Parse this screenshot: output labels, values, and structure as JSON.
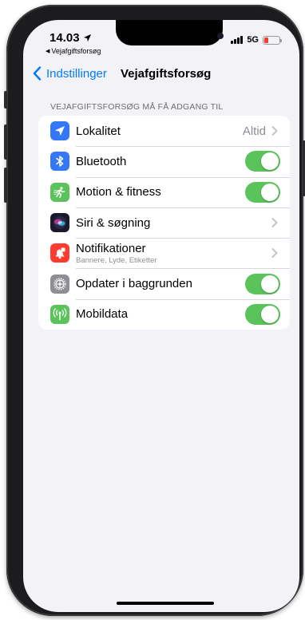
{
  "status_bar": {
    "time": "14.03",
    "back_app_label": "Vejafgiftsforsøg",
    "network": "5G",
    "battery_color": "#ff3b30"
  },
  "nav": {
    "back_label": "Indstillinger",
    "title": "Vejafgiftsforsøg"
  },
  "section": {
    "header": "VEJAFGIFTSFORSØG MÅ FÅ ADGANG TIL",
    "rows": [
      {
        "label": "Lokalitet",
        "value": "Altid",
        "icon": "location-arrow-icon",
        "icon_color": "#3478f6",
        "control": "disclosure"
      },
      {
        "label": "Bluetooth",
        "icon": "bluetooth-icon",
        "icon_color": "#3478f6",
        "control": "toggle",
        "on": true
      },
      {
        "label": "Motion & fitness",
        "icon": "running-figure-icon",
        "icon_color": "#5ac35a",
        "control": "toggle",
        "on": true
      },
      {
        "label": "Siri & søgning",
        "icon": "siri-icon",
        "icon_color": "#1a1a2e",
        "control": "disclosure"
      },
      {
        "label": "Notifikationer",
        "sublabel": "Bannere, Lyde, Etiketter",
        "icon": "bell-icon",
        "icon_color": "#ff3b30",
        "control": "disclosure"
      },
      {
        "label": "Opdater i baggrunden",
        "icon": "gear-icon",
        "icon_color": "#8e8e93",
        "control": "toggle",
        "on": true
      },
      {
        "label": "Mobildata",
        "icon": "antenna-icon",
        "icon_color": "#5ac35a",
        "control": "toggle",
        "on": true
      }
    ]
  },
  "colors": {
    "accent": "#007aff",
    "toggle_on": "#5ac35a",
    "background": "#f2f2f7"
  }
}
